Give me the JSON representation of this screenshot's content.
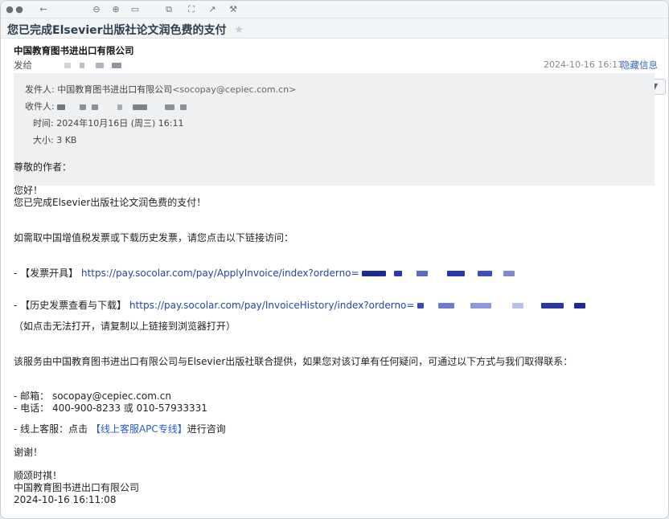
{
  "email": {
    "subject": "您已完成Elsevier出版社论文润色费的支付",
    "sender_name": "中国教育图书进出口有限公司",
    "sendto_label": "发给",
    "timestamp": "2024-10-16 16:11",
    "hide_details": "隐藏信息",
    "details": {
      "from_label": "发件人:",
      "from_name": "中国教育图书进出口有限公司",
      "from_addr": "<socopay@cepiec.com.cn>",
      "to_label": "收件人:",
      "time_label": "时间:",
      "time_value": "2024年10月16日 (周三) 16:11",
      "size_label": "大小:",
      "size_value": "3 KB"
    },
    "body": {
      "greeting": "尊敬的作者：",
      "hello": "您好！",
      "done": "您已完成Elsevier出版社论文润色费的支付！",
      "need": "如需取中国增值税发票或下载历史发票，请您点击以下链接访问：",
      "invoice_prefix": "- 【发票开具】",
      "invoice_link": "https://pay.socolar.com/pay/ApplyInvoice/index?orderno=",
      "history_prefix": "- 【历史发票查看与下载】",
      "history_link": "https://pay.socolar.com/pay/InvoiceHistory/index?orderno=",
      "note": "（如点击无法打开，请复制以上链接到浏览器打开）",
      "service": "该服务由中国教育图书进出口有限公司与Elsevier出版社联合提供，如果您对该订单有任何疑问，可通过以下方式与我们取得联系：",
      "email_line": "- 邮箱：  socopay@cepiec.com.cn",
      "phone_line": "- 电话：  400-900-8233 或 010-57933331",
      "support_prefix": "- 线上客服：点击 ",
      "support_link": "【线上客服APC专线】",
      "support_suffix": "进行咨询",
      "thanks": "谢谢！",
      "regards": "顺颂时祺！",
      "sign_company": "中国教育图书进出口有限公司",
      "sign_time": "2024-10-16 16:11:08"
    }
  },
  "toolbar": {
    "icons": [
      "close-icon",
      "minimize-icon",
      "back-icon",
      "zoom-out-icon",
      "zoom-in-icon",
      "fit-icon",
      "copy-icon",
      "screenshot-icon",
      "open-window-icon",
      "tools-icon"
    ]
  },
  "colors": {
    "accent": "#2546a8",
    "subject": "#2c3e50"
  }
}
